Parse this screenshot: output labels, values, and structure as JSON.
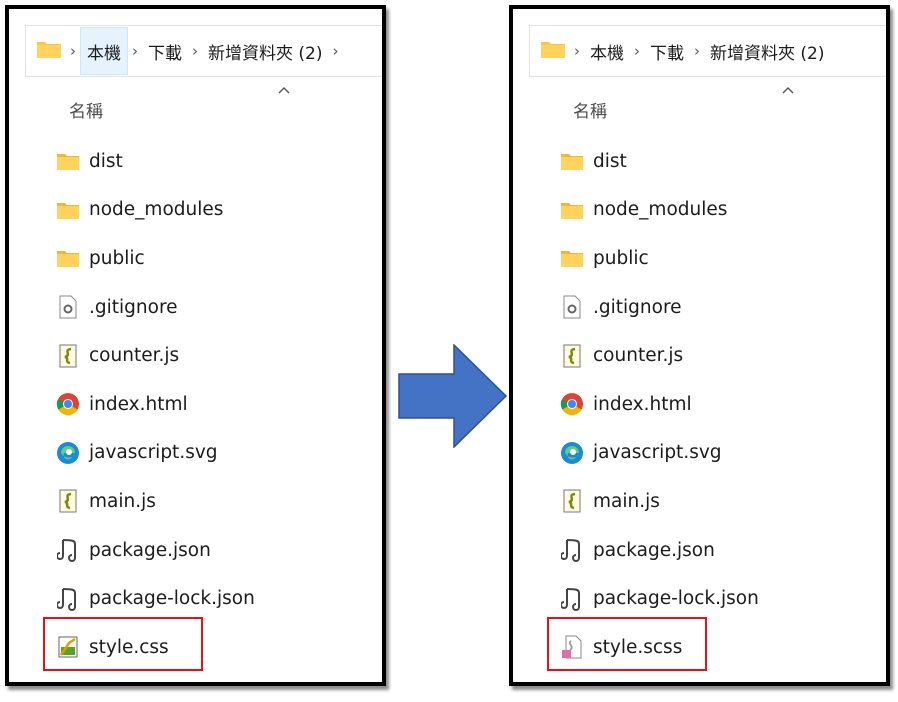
{
  "colors": {
    "accent_arrow": "#4472c4",
    "highlight": "#e0141a",
    "folder": "#f7c64a"
  },
  "panels": [
    {
      "breadcrumb": [
        "本機",
        "下載",
        "新增資料夾 (2)"
      ],
      "header": {
        "name_col": "名稱"
      },
      "files": [
        {
          "name": "dist",
          "icon": "folder-icon"
        },
        {
          "name": "node_modules",
          "icon": "folder-icon"
        },
        {
          "name": "public",
          "icon": "folder-icon"
        },
        {
          "name": ".gitignore",
          "icon": "settings-file-icon"
        },
        {
          "name": "counter.js",
          "icon": "script-file-icon"
        },
        {
          "name": "index.html",
          "icon": "chrome-icon"
        },
        {
          "name": "javascript.svg",
          "icon": "edge-icon"
        },
        {
          "name": "main.js",
          "icon": "script-file-icon"
        },
        {
          "name": "package.json",
          "icon": "json-file-icon"
        },
        {
          "name": "package-lock.json",
          "icon": "json-file-icon"
        },
        {
          "name": "style.css",
          "icon": "css-file-icon"
        }
      ]
    },
    {
      "breadcrumb": [
        "本機",
        "下載",
        "新增資料夾 (2)"
      ],
      "header": {
        "name_col": "名稱"
      },
      "files": [
        {
          "name": "dist",
          "icon": "folder-icon"
        },
        {
          "name": "node_modules",
          "icon": "folder-icon"
        },
        {
          "name": "public",
          "icon": "folder-icon"
        },
        {
          "name": ".gitignore",
          "icon": "settings-file-icon"
        },
        {
          "name": "counter.js",
          "icon": "script-file-icon"
        },
        {
          "name": "index.html",
          "icon": "chrome-icon"
        },
        {
          "name": "javascript.svg",
          "icon": "edge-icon"
        },
        {
          "name": "main.js",
          "icon": "script-file-icon"
        },
        {
          "name": "package.json",
          "icon": "json-file-icon"
        },
        {
          "name": "package-lock.json",
          "icon": "json-file-icon"
        },
        {
          "name": "style.scss",
          "icon": "scss-file-icon"
        }
      ]
    }
  ]
}
